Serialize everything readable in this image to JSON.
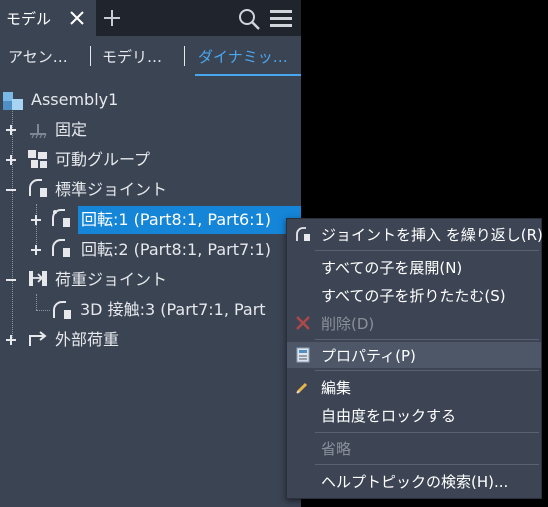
{
  "titlebar": {
    "tab_label": "モデル"
  },
  "subtabs": [
    {
      "label": "アセン…"
    },
    {
      "label": "モデリ…"
    },
    {
      "label": "ダイナミッ…"
    }
  ],
  "tree": {
    "root": "Assembly1",
    "fixed": "固定",
    "movable_group": "可動グループ",
    "standard_joint": "標準ジョイント",
    "rotation1": "回転:1 (Part8:1, Part6:1)",
    "rotation2": "回転:2 (Part8:1, Part7:1)",
    "load_joint": "荷重ジョイント",
    "contact3": "3D 接触:3 (Part7:1, Part",
    "external_load": "外部荷重"
  },
  "context_menu": {
    "items": [
      {
        "label": "ジョイントを挿入 を繰り返し(R)",
        "icon": "joint-icon",
        "enabled": true
      },
      {
        "label": "すべての子を展開(N)",
        "enabled": true
      },
      {
        "label": "すべての子を折りたたむ(S)",
        "enabled": true
      },
      {
        "label": "削除(D)",
        "icon": "delete-icon",
        "enabled": false
      },
      {
        "label": "プロパティ(P)",
        "icon": "properties-icon",
        "enabled": true
      },
      {
        "label": "編集",
        "icon": "pencil-icon",
        "enabled": true
      },
      {
        "label": "自由度をロックする",
        "enabled": true
      },
      {
        "label": "省略",
        "enabled": false
      },
      {
        "label": "ヘルプトピックの検索(H)...",
        "enabled": true
      }
    ]
  },
  "colors": {
    "panel_bg": "#3b4453",
    "titlebar_bg": "#1f242d",
    "accent": "#4aa6ef",
    "selection": "#1585d8",
    "menu_bg": "#3d4554"
  }
}
